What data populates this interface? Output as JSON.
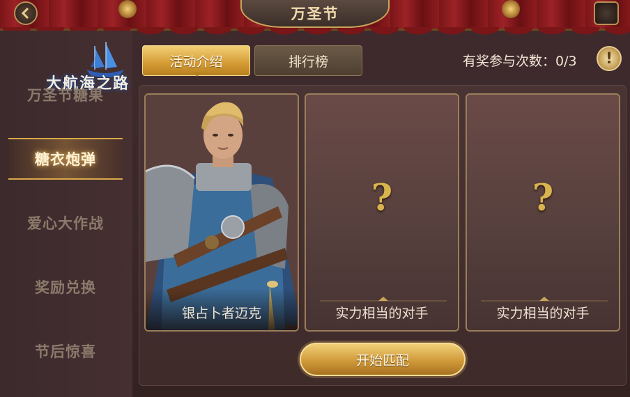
{
  "window": {
    "title": "万圣节"
  },
  "logo": {
    "text": "大航海之路"
  },
  "sidebar": {
    "items": [
      {
        "label": "万圣节糖果",
        "active": false
      },
      {
        "label": "糖衣炮弹",
        "active": true
      },
      {
        "label": "爱心大作战",
        "active": false
      },
      {
        "label": "奖励兑换",
        "active": false
      },
      {
        "label": "节后惊喜",
        "active": false
      }
    ]
  },
  "tabs": [
    {
      "label": "活动介绍",
      "active": true
    },
    {
      "label": "排行榜",
      "active": false
    }
  ],
  "reward": {
    "text": "有奖参与次数：0/3"
  },
  "info_icon": {
    "glyph": "!"
  },
  "cards": [
    {
      "label": "银占卜者迈克",
      "type": "character"
    },
    {
      "label": "实力相当的对手",
      "glyph": "?",
      "type": "unknown"
    },
    {
      "label": "实力相当的对手",
      "glyph": "?",
      "type": "unknown"
    }
  ],
  "start_button": {
    "label": "开始匹配"
  },
  "colors": {
    "accent_gold": "#d49b35",
    "curtain_red": "#8e1c20",
    "panel": "#4a3433"
  }
}
